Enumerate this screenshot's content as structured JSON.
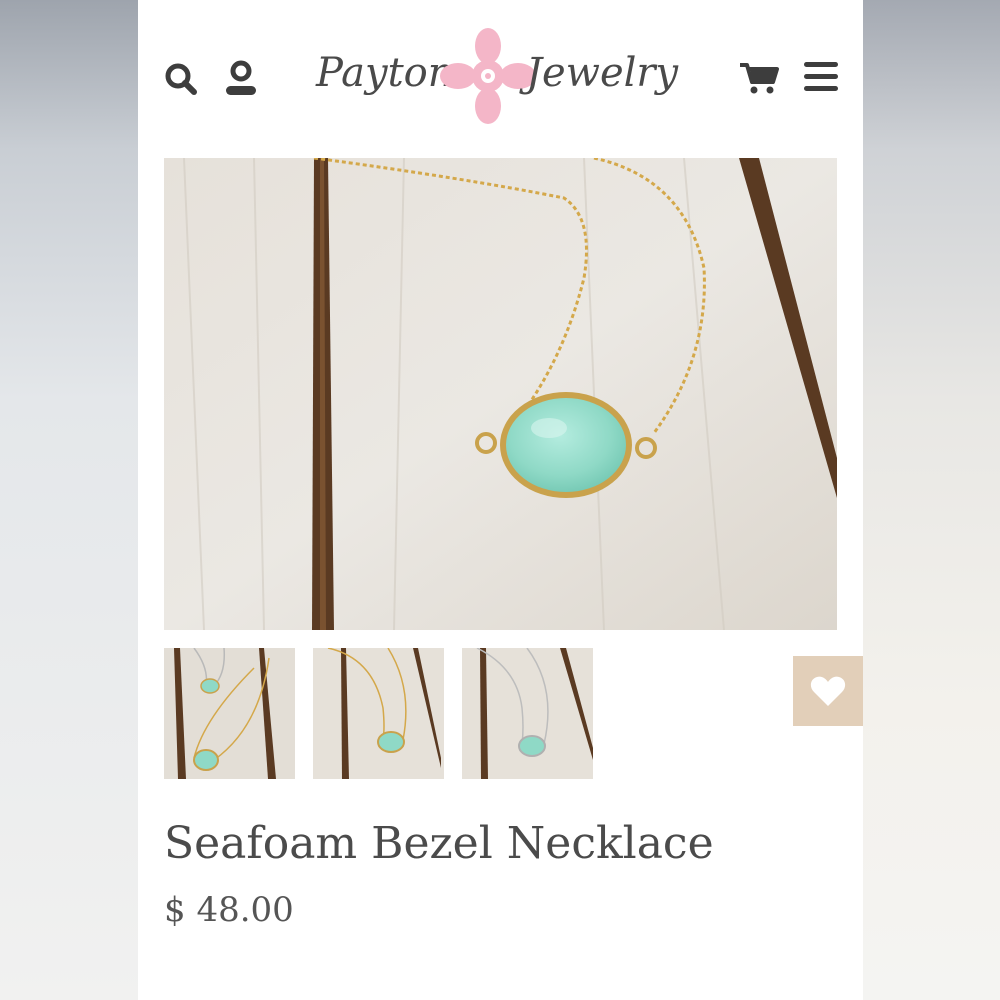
{
  "store": {
    "logo_left": "Payton",
    "logo_right": "Jewelry"
  },
  "header": {
    "icons": [
      "search-icon",
      "account-icon",
      "cart-icon",
      "menu-icon"
    ]
  },
  "product": {
    "title": "Seafoam Bezel Necklace",
    "price": "$ 48.00",
    "thumbnail_count": 3
  },
  "colors": {
    "accent_pink": "#f4b6c8",
    "favorite_bg": "#e2cfb9",
    "text": "#4b4b4b",
    "stone": "#8fd9c6",
    "gold": "#d4a84a"
  }
}
